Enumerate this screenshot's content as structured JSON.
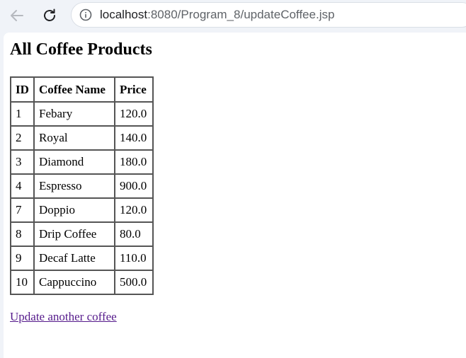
{
  "browser": {
    "url_host": "localhost",
    "url_rest": ":8080/Program_8/updateCoffee.jsp"
  },
  "page": {
    "title": "All Coffee Products",
    "columns": [
      "ID",
      "Coffee Name",
      "Price"
    ],
    "rows": [
      {
        "id": "1",
        "name": "Febary",
        "price": "120.0"
      },
      {
        "id": "2",
        "name": "Royal",
        "price": "140.0"
      },
      {
        "id": "3",
        "name": "Diamond",
        "price": "180.0"
      },
      {
        "id": "4",
        "name": "Espresso",
        "price": "900.0"
      },
      {
        "id": "7",
        "name": "Doppio",
        "price": "120.0"
      },
      {
        "id": "8",
        "name": "Drip Coffee",
        "price": "80.0"
      },
      {
        "id": "9",
        "name": "Decaf Latte",
        "price": "110.0"
      },
      {
        "id": "10",
        "name": "Cappuccino",
        "price": "500.0"
      }
    ],
    "link_text": "Update another coffee"
  }
}
